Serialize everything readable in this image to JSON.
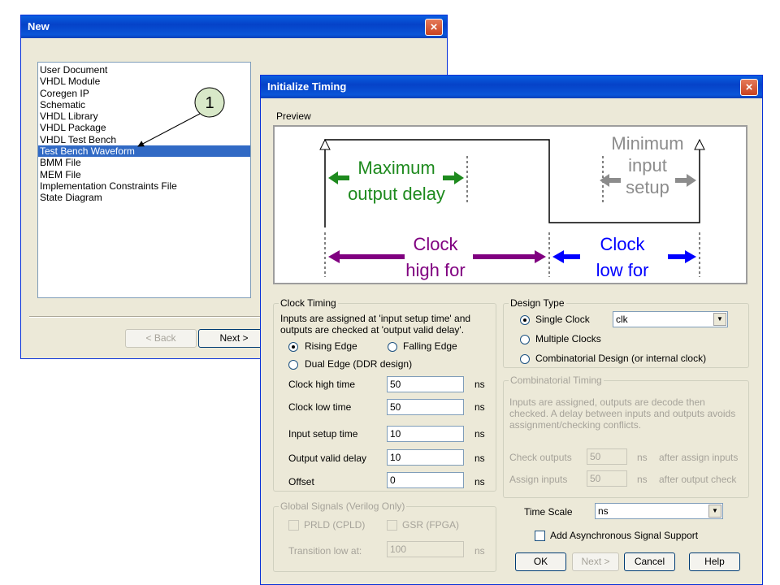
{
  "new_dialog": {
    "title": "New",
    "items": [
      "User Document",
      "VHDL Module",
      "Coregen IP",
      "Schematic",
      "VHDL Library",
      "VHDL Package",
      "VHDL Test Bench",
      "Test Bench Waveform",
      "BMM File",
      "MEM File",
      "Implementation Constraints File",
      "State Diagram"
    ],
    "selected_index": 7,
    "back_label": "< Back",
    "next_label": "Next >",
    "callout_number": "1"
  },
  "timing_dialog": {
    "title": "Initialize Timing",
    "preview_label": "Preview",
    "preview": {
      "max_output_delay": [
        "Maximum",
        "output delay"
      ],
      "min_input_setup": [
        "Minimum",
        "input",
        "setup"
      ],
      "clock_high": [
        "Clock",
        "high for"
      ],
      "clock_low": [
        "Clock",
        "low for"
      ],
      "colors": {
        "green": "#1e8a1e",
        "gray": "#8c8c8c",
        "purple": "#800080",
        "blue": "#0000ff"
      }
    },
    "clock_timing": {
      "legend": "Clock Timing",
      "desc_line1": "Inputs are assigned at 'input setup time' and",
      "desc_line2": "outputs are checked at 'output valid delay'.",
      "rising_edge": "Rising Edge",
      "falling_edge": "Falling Edge",
      "dual_edge": "Dual Edge (DDR design)",
      "rows": [
        {
          "label": "Clock high time",
          "value": "50",
          "unit": "ns"
        },
        {
          "label": "Clock low time",
          "value": "50",
          "unit": "ns"
        },
        {
          "label": "Input setup time",
          "value": "10",
          "unit": "ns"
        },
        {
          "label": "Output valid delay",
          "value": "10",
          "unit": "ns"
        },
        {
          "label": "Offset",
          "value": "0",
          "unit": "ns"
        }
      ]
    },
    "design_type": {
      "legend": "Design Type",
      "single_clock": "Single Clock",
      "clock_name": "clk",
      "multiple_clocks": "Multiple Clocks",
      "combinatorial": "Combinatorial Design (or internal clock)"
    },
    "combinatorial_timing": {
      "legend": "Combinatorial Timing",
      "desc_line1": "Inputs are assigned, outputs are decode then",
      "desc_line2": "checked.  A delay between inputs and outputs avoids",
      "desc_line3": "assignment/checking conflicts.",
      "check_label": "Check outputs",
      "check_value": "50",
      "check_after": "after assign inputs",
      "assign_label": "Assign inputs",
      "assign_value": "50",
      "assign_after": "after output check",
      "unit": "ns"
    },
    "global_signals": {
      "legend": "Global Signals (Verilog Only)",
      "prld": "PRLD (CPLD)",
      "gsr": "GSR (FPGA)",
      "transition_label": "Transition low at:",
      "transition_value": "100",
      "unit": "ns"
    },
    "time_scale": {
      "label": "Time Scale",
      "value": "ns"
    },
    "async_label": "Add Asynchronous Signal Support",
    "buttons": {
      "ok": "OK",
      "next": "Next >",
      "cancel": "Cancel",
      "help": "Help"
    },
    "close_icon": "×"
  }
}
